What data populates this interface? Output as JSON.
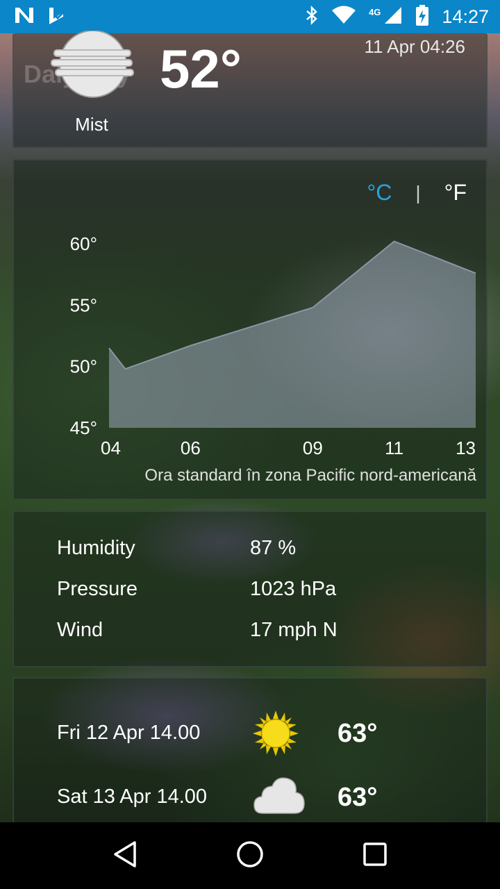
{
  "status_bar": {
    "time": "14:27",
    "network": "4G",
    "icons": [
      "n-notification-icon",
      "checkmark-notification-icon",
      "bluetooth-icon",
      "wifi-icon",
      "signal-icon",
      "battery-charging-icon"
    ]
  },
  "current": {
    "city_ghost": "Daly City",
    "condition": "Mist",
    "temperature": "52°",
    "timestamp": "11 Apr 04:26",
    "icon": "mist-icon"
  },
  "units": {
    "celsius": "°C",
    "separator": "|",
    "fahrenheit": "°F",
    "active": "°C",
    "active_color": "#29a3df"
  },
  "chart_data": {
    "type": "area",
    "x_tick_labels": [
      "04",
      "06",
      "09",
      "11",
      "13"
    ],
    "x_hours": [
      4,
      4.4,
      6,
      9,
      11,
      13
    ],
    "values": [
      51.5,
      49.8,
      51.7,
      54.8,
      60.2,
      57.6
    ],
    "y_ticks": [
      "60°",
      "55°",
      "50°",
      "45°"
    ],
    "ylim": [
      45,
      60
    ],
    "xlim": [
      4,
      13
    ],
    "grid": false,
    "fill_color": "#9aa6b8",
    "line_color": "#8a96a8"
  },
  "timezone_label": "Ora standard în zona Pacific nord-americană",
  "details": [
    {
      "label": "Humidity",
      "value": "87 %"
    },
    {
      "label": "Pressure",
      "value": "1023 hPa"
    },
    {
      "label": "Wind",
      "value": "17 mph N"
    }
  ],
  "forecast": [
    {
      "date": "Fri 12 Apr 14.00",
      "icon": "sun-icon",
      "temp": "63°"
    },
    {
      "date": "Sat 13 Apr 14.00",
      "icon": "cloud-icon",
      "temp": "63°"
    }
  ],
  "nav": {
    "icons": [
      "back-icon",
      "home-icon",
      "recents-icon"
    ]
  }
}
